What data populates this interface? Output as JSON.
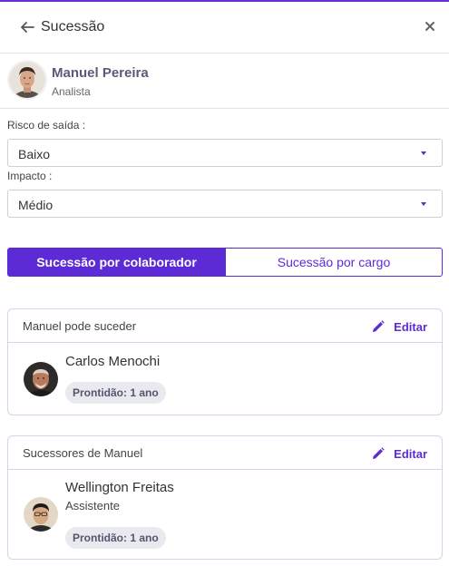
{
  "header": {
    "title": "Sucessão"
  },
  "profile": {
    "name": "Manuel Pereira",
    "role": "Analista"
  },
  "fields": {
    "risk": {
      "label": "Risco de saída :",
      "value": "Baixo"
    },
    "impact": {
      "label": "Impacto :",
      "value": "Médio"
    }
  },
  "tabs": [
    {
      "label": "Sucessão por colaborador",
      "active": true
    },
    {
      "label": "Sucessão por cargo",
      "active": false
    }
  ],
  "cards": [
    {
      "title": "Manuel pode suceder",
      "edit_label": "Editar",
      "person": {
        "name": "Carlos Menochi",
        "readiness": "Prontidão: 1 ano"
      }
    },
    {
      "title": "Sucessores de Manuel",
      "edit_label": "Editar",
      "person": {
        "name": "Wellington Freitas",
        "role": "Assistente",
        "readiness": "Prontidão: 1 ano"
      }
    }
  ],
  "colors": {
    "accent": "#5d2bd6",
    "card_border": "#d6d4ec",
    "badge_bg": "#e9e9f0"
  },
  "icons": {
    "back": "arrow-left-icon",
    "close": "close-icon",
    "edit": "pencil-icon",
    "caret": "caret-down-icon"
  }
}
